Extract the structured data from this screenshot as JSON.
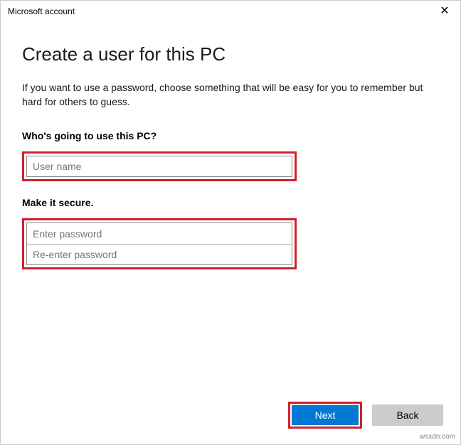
{
  "window": {
    "title": "Microsoft account"
  },
  "main": {
    "heading": "Create a user for this PC",
    "description": "If you want to use a password, choose something that will be easy for you to remember but hard for others to guess.",
    "section_user_label": "Who's going to use this PC?",
    "section_secure_label": "Make it secure.",
    "username_placeholder": "User name",
    "password_placeholder": "Enter password",
    "reenter_placeholder": "Re-enter password"
  },
  "footer": {
    "next_label": "Next",
    "back_label": "Back"
  },
  "watermark": "wsxdn.com"
}
